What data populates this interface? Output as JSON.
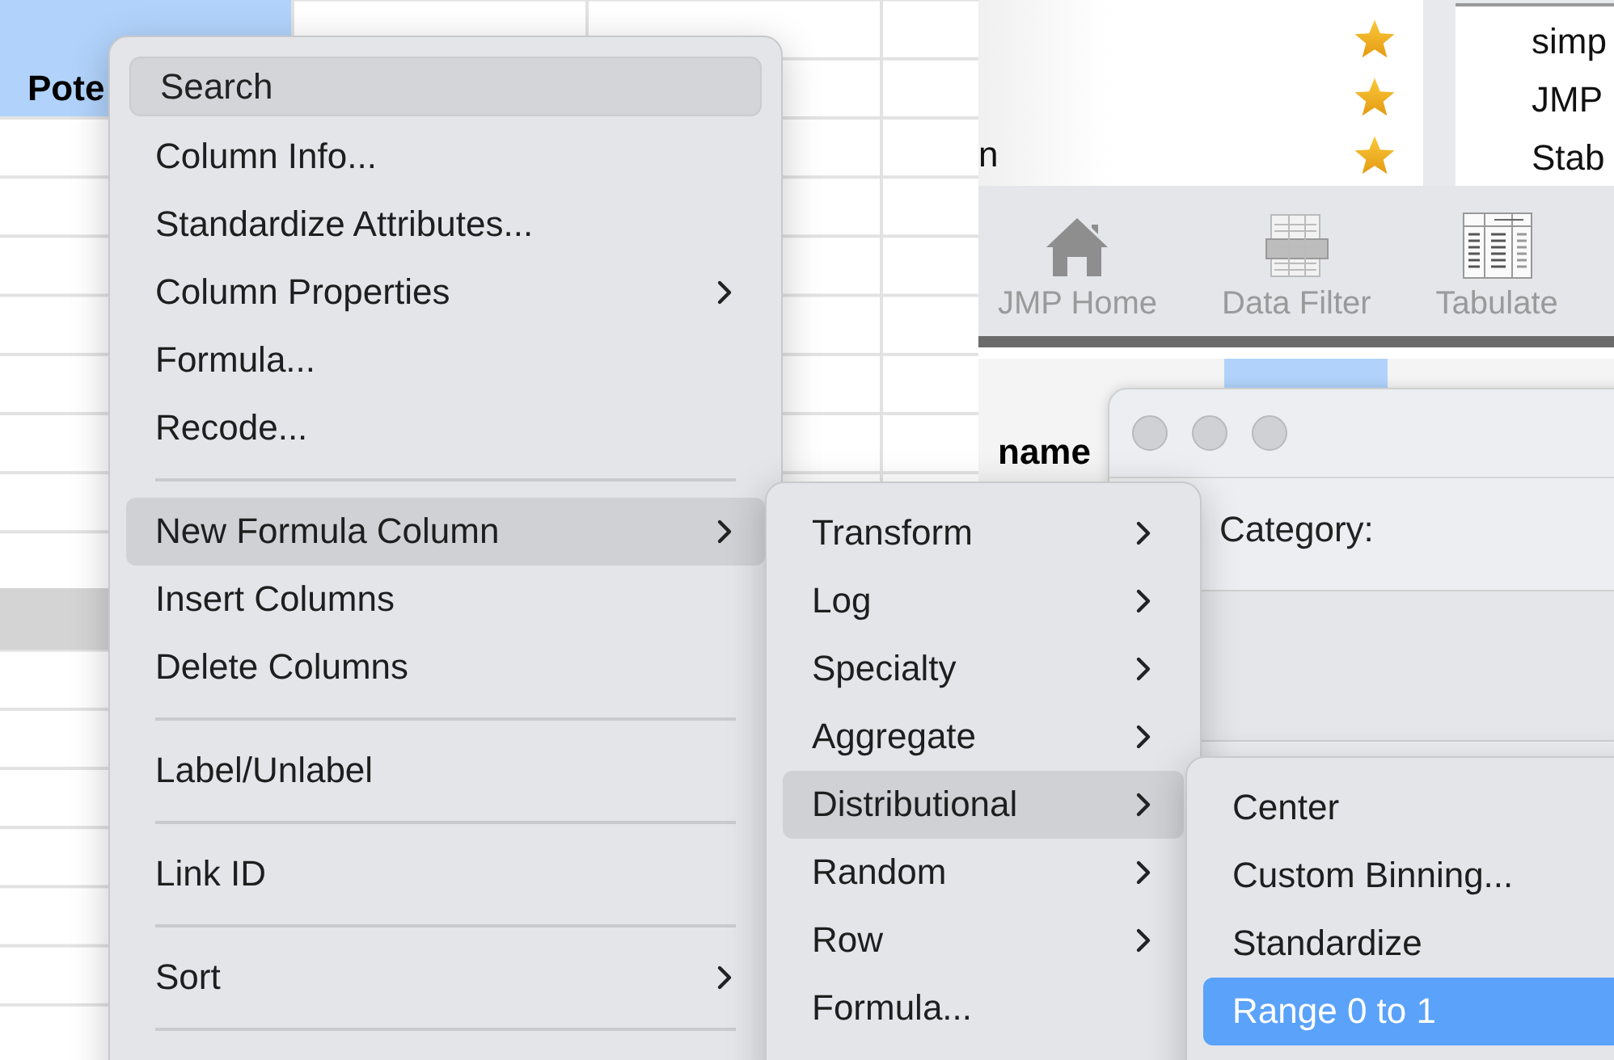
{
  "data_table": {
    "column_header": "Pote"
  },
  "favorites": {
    "rows": [
      {
        "starred": true
      },
      {
        "starred": true
      },
      {
        "label": "n",
        "starred": true
      }
    ]
  },
  "recent_files": [
    "simp",
    "JMP",
    "Stab"
  ],
  "toolbar": [
    {
      "label": "JMP Home",
      "kind": "home"
    },
    {
      "label": "Data Filter",
      "kind": "filter"
    },
    {
      "label": "Tabulate",
      "kind": "tabulate"
    }
  ],
  "second_table": {
    "column_header": "name"
  },
  "dialog": {
    "label": "Category:"
  },
  "context_menu": {
    "search": {
      "placeholder": "Search"
    },
    "items": [
      {
        "kind": "item",
        "label": "Column Info...",
        "submenu": false,
        "selected": false
      },
      {
        "kind": "item",
        "label": "Standardize Attributes...",
        "submenu": false,
        "selected": false
      },
      {
        "kind": "item",
        "label": "Column Properties",
        "submenu": true,
        "selected": false
      },
      {
        "kind": "item",
        "label": "Formula...",
        "submenu": false,
        "selected": false
      },
      {
        "kind": "item",
        "label": "Recode...",
        "submenu": false,
        "selected": false
      },
      {
        "kind": "separator"
      },
      {
        "kind": "item",
        "label": "New Formula Column",
        "submenu": true,
        "selected": true
      },
      {
        "kind": "item",
        "label": "Insert Columns",
        "submenu": false,
        "selected": false
      },
      {
        "kind": "item",
        "label": "Delete Columns",
        "submenu": false,
        "selected": false
      },
      {
        "kind": "separator"
      },
      {
        "kind": "item",
        "label": "Label/Unlabel",
        "submenu": false,
        "selected": false
      },
      {
        "kind": "separator"
      },
      {
        "kind": "item",
        "label": "Link ID",
        "submenu": false,
        "selected": false
      },
      {
        "kind": "separator"
      },
      {
        "kind": "item",
        "label": "Sort",
        "submenu": true,
        "selected": false
      },
      {
        "kind": "separator"
      }
    ]
  },
  "formula_submenu": {
    "items": [
      {
        "kind": "item",
        "label": "Transform",
        "submenu": true,
        "selected": false
      },
      {
        "kind": "item",
        "label": "Log",
        "submenu": true,
        "selected": false
      },
      {
        "kind": "item",
        "label": "Specialty",
        "submenu": true,
        "selected": false
      },
      {
        "kind": "item",
        "label": "Aggregate",
        "submenu": true,
        "selected": false
      },
      {
        "kind": "item",
        "label": "Distributional",
        "submenu": true,
        "selected": true
      },
      {
        "kind": "item",
        "label": "Random",
        "submenu": true,
        "selected": false
      },
      {
        "kind": "item",
        "label": "Row",
        "submenu": true,
        "selected": false
      },
      {
        "kind": "item",
        "label": "Formula...",
        "submenu": false,
        "selected": false
      }
    ]
  },
  "distributional_submenu": {
    "items": [
      {
        "kind": "item",
        "label": "Center",
        "submenu": false,
        "selected": false
      },
      {
        "kind": "item",
        "label": "Custom Binning...",
        "submenu": false,
        "selected": false
      },
      {
        "kind": "item",
        "label": "Standardize",
        "submenu": false,
        "selected": false
      },
      {
        "kind": "item",
        "label": "Range 0 to 1",
        "submenu": false,
        "selected": true
      }
    ]
  }
}
